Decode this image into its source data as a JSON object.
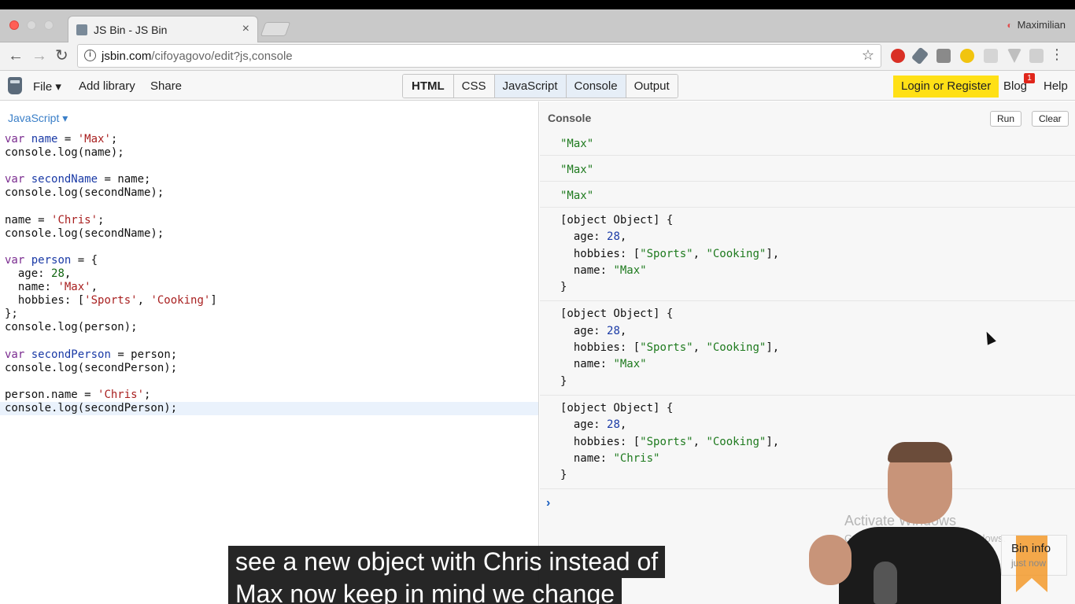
{
  "browser": {
    "tab_title": "JS Bin - JS Bin",
    "tab_close": "×",
    "profile_name": "Maximilian",
    "url_host": "jsbin.com",
    "url_path": "/cifoyagovo/edit?js,console",
    "back": "←",
    "forward": "→",
    "reload": "↻",
    "star": "☆",
    "menu": "⋮"
  },
  "toolbar": {
    "file": "File ▾",
    "add_library": "Add library",
    "share": "Share",
    "panels": [
      {
        "label": "HTML"
      },
      {
        "label": "CSS"
      },
      {
        "label": "JavaScript"
      },
      {
        "label": "Console"
      },
      {
        "label": "Output"
      }
    ],
    "login": "Login or Register",
    "blog": "Blog",
    "blog_badge": "1",
    "help": "Help"
  },
  "editor": {
    "language": "JavaScript ▾",
    "lines": [
      "var name = 'Max';",
      "console.log(name);",
      "",
      "var secondName = name;",
      "console.log(secondName);",
      "",
      "name = 'Chris';",
      "console.log(secondName);",
      "",
      "var person = {",
      "  age: 28,",
      "  name: 'Max',",
      "  hobbies: ['Sports', 'Cooking']",
      "};",
      "console.log(person);",
      "",
      "var secondPerson = person;",
      "console.log(secondPerson);",
      "",
      "person.name = 'Chris';",
      "console.log(secondPerson);"
    ]
  },
  "console": {
    "title": "Console",
    "run": "Run",
    "clear": "Clear",
    "prompt": "›",
    "entries": [
      [
        "\"Max\""
      ],
      [
        "\"Max\""
      ],
      [
        "\"Max\""
      ],
      [
        "[object Object] {",
        "  age: 28,",
        "  hobbies: [\"Sports\", \"Cooking\"],",
        "  name: \"Max\"",
        "}"
      ],
      [
        "[object Object] {",
        "  age: 28,",
        "  hobbies: [\"Sports\", \"Cooking\"],",
        "  name: \"Max\"",
        "}"
      ],
      [
        "[object Object] {",
        "  age: 28,",
        "  hobbies: [\"Sports\", \"Cooking\"],",
        "  name: \"Chris\"",
        "}"
      ]
    ]
  },
  "overlay": {
    "watermark_title": "Activate Windows",
    "watermark_sub": "Go to Settings to activate Windows.",
    "bin_info": "Bin info",
    "bin_info_sub": "just now",
    "caption_lines": [
      "see a new object with Chris instead of",
      "Max now keep in mind we change"
    ]
  }
}
